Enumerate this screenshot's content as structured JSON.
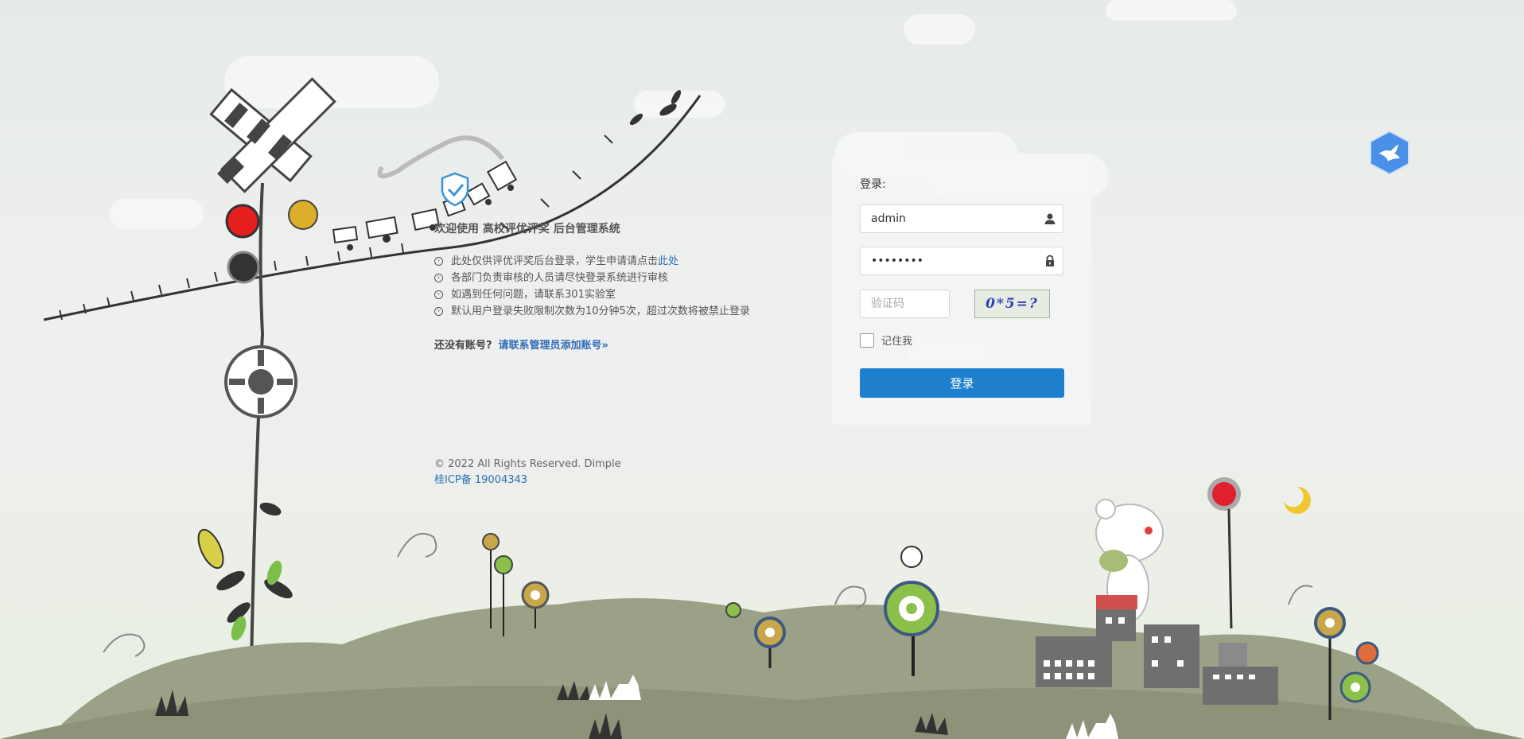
{
  "welcome": {
    "title": "欢迎使用 高校评优评奖 后台管理系统",
    "notices": [
      {
        "text": "此处仅供评优评奖后台登录，学生申请请点击",
        "link": "此处"
      },
      {
        "text": "各部门负责审核的人员请尽快登录系统进行审核"
      },
      {
        "text": "如遇到任何问题，请联系301实验室"
      },
      {
        "text": "默认用户登录失败限制次数为10分钟5次，超过次数将被禁止登录"
      }
    ],
    "no_account_label": "还没有账号?",
    "no_account_link": "请联系管理员添加账号»"
  },
  "footer": {
    "copyright": "© 2022 All Rights Reserved. Dimple",
    "icp": "桂ICP备 19004343"
  },
  "login": {
    "label": "登录:",
    "username_value": "admin",
    "password_value": "••••••••",
    "captcha_placeholder": "验证码",
    "captcha_text": "0*5=?",
    "remember_label": "记住我",
    "submit_label": "登录"
  },
  "icons": {
    "username": "user-icon",
    "password": "lock-icon",
    "notice_bullet": "circle-arrow-icon",
    "brand": "bird-shield-icon"
  }
}
